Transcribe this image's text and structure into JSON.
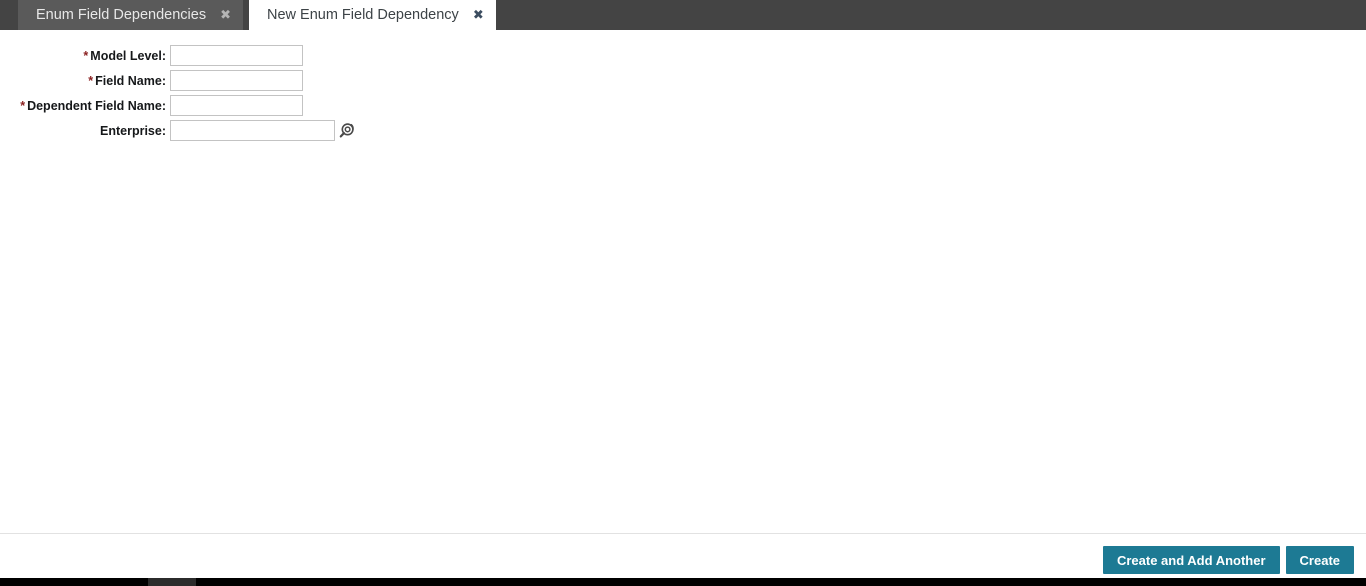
{
  "tabs": [
    {
      "label": "Enum Field Dependencies",
      "close_icon": "close-icon",
      "close_glyph": "✖",
      "active": false
    },
    {
      "label": "New Enum Field Dependency",
      "close_icon": "close-icon",
      "close_glyph": "✖",
      "active": true
    }
  ],
  "form": {
    "fields": [
      {
        "label": "Model Level:",
        "required": true,
        "star": "*",
        "value": "",
        "placeholder": "",
        "width": "narrow",
        "lookup": false
      },
      {
        "label": "Field Name:",
        "required": true,
        "star": "*",
        "value": "",
        "placeholder": "",
        "width": "narrow",
        "lookup": false
      },
      {
        "label": "Dependent Field Name:",
        "required": true,
        "star": "*",
        "value": "",
        "placeholder": "",
        "width": "narrow",
        "lookup": false
      },
      {
        "label": "Enterprise:",
        "required": false,
        "star": "",
        "value": "",
        "placeholder": "",
        "width": "wide",
        "lookup": true,
        "lookup_icon": "search-lookup-icon"
      }
    ]
  },
  "footer": {
    "buttons": [
      {
        "label": "Create and Add Another",
        "name": "create-and-add-another-button"
      },
      {
        "label": "Create",
        "name": "create-button"
      }
    ]
  },
  "colors": {
    "tab_bar_bg": "#444444",
    "tab_inactive_bg": "#5a5a5a",
    "tab_active_bg": "#ffffff",
    "accent_button": "#1d7a94",
    "required_star": "#8a1f1f",
    "input_border": "#c3c3c3",
    "bottom_bar": "#000000"
  }
}
